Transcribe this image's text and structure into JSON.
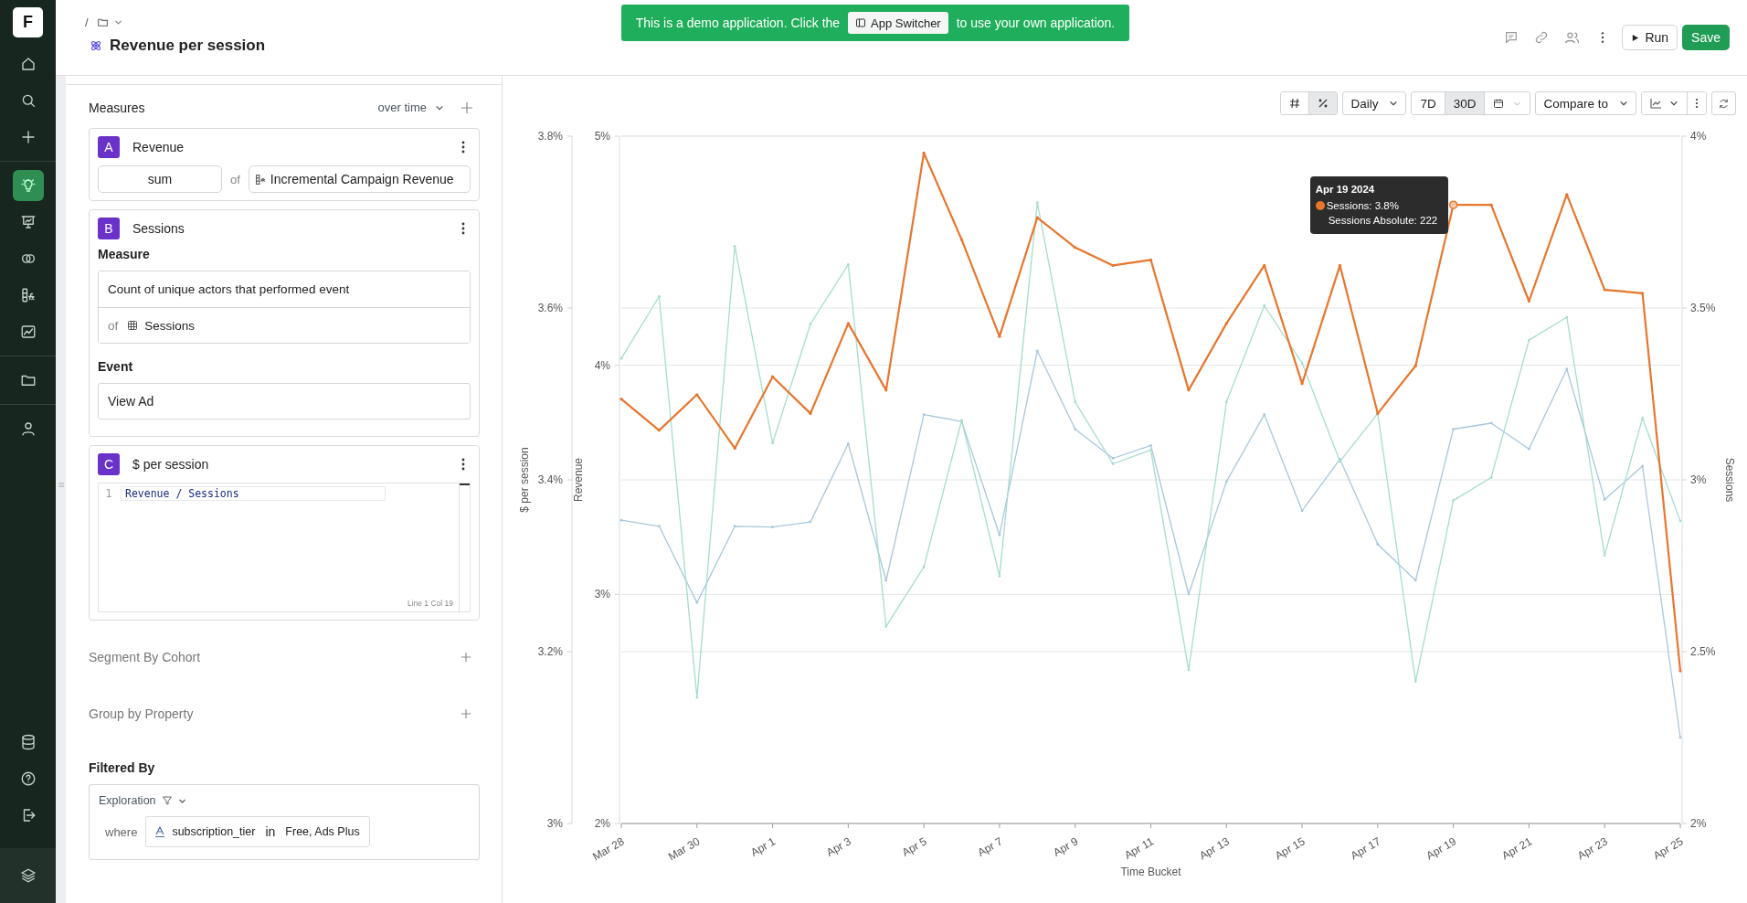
{
  "sidebar": {
    "logo": "F",
    "top_groups": [
      [
        {
          "kind": "home",
          "selected": false
        },
        {
          "kind": "search",
          "selected": false
        },
        {
          "kind": "plus",
          "selected": false
        }
      ],
      [
        {
          "kind": "bulb",
          "selected": true
        },
        {
          "kind": "presentation",
          "selected": false
        },
        {
          "kind": "circles",
          "selected": false
        },
        {
          "kind": "formula",
          "selected": false
        },
        {
          "kind": "chart",
          "selected": false
        }
      ],
      [
        {
          "kind": "folder",
          "selected": false
        }
      ],
      [
        {
          "kind": "user",
          "selected": false
        }
      ]
    ],
    "bottom": [
      {
        "kind": "database",
        "selected": false
      },
      {
        "kind": "help",
        "selected": false
      },
      {
        "kind": "logout",
        "selected": false
      }
    ]
  },
  "header": {
    "breadcrumb_separator": "/",
    "title": "Revenue per session",
    "banner": {
      "before": "This is a demo application. Click the",
      "button": "App Switcher",
      "after": "to use your own application."
    },
    "run": "Run",
    "save": "Save"
  },
  "measures": {
    "title": "Measures",
    "mode": "over time",
    "items": [
      {
        "kind": "aggregate",
        "letter": "A",
        "name": "Revenue",
        "aggregation": "sum",
        "of": "of",
        "property": "Incremental Campaign Revenue"
      },
      {
        "kind": "event",
        "letter": "B",
        "name": "Sessions",
        "measure_label": "Measure",
        "measure": "Count of unique actors that performed event",
        "of": "of",
        "table": "Sessions",
        "event_label": "Event",
        "event": "View Ad"
      },
      {
        "kind": "formula",
        "letter": "C",
        "name": "$ per session",
        "line_number": "1",
        "formula": "Revenue / Sessions",
        "cursor": "Line 1 Col 19"
      }
    ]
  },
  "sections": [
    {
      "title": "Segment By Cohort"
    },
    {
      "title": "Group by Property"
    }
  ],
  "filters": {
    "title": "Filtered By",
    "scope": "Exploration",
    "conditions": [
      {
        "where": "where",
        "property": "subscription_tier",
        "operator": "in",
        "values": "Free, Ads Plus"
      }
    ]
  },
  "chart_toolbar": {
    "format": [
      {
        "kind": "number",
        "selected": false
      },
      {
        "kind": "percent",
        "selected": true
      }
    ],
    "granularity": "Daily",
    "ranges": [
      {
        "label": "7D",
        "selected": false
      },
      {
        "label": "30D",
        "selected": true
      }
    ],
    "compare": "Compare to"
  },
  "chart": {
    "tooltip": {
      "color": "#e8762c",
      "lines": [
        {
          "kind": "value",
          "text": "Sessions: 3.8%"
        },
        {
          "kind": "detail",
          "text": "Sessions Absolute: 222"
        }
      ]
    },
    "chart_data": {
      "type": "line",
      "xlabel": "Time Bucket",
      "ylabel": "Revenue",
      "y2label": "Sessions",
      "y3label": "$ per session",
      "grid": true,
      "categories": [
        "Mar 28",
        null,
        "Mar 30",
        null,
        "Apr 1",
        null,
        "Apr 3",
        null,
        "Apr 5",
        null,
        "Apr 7",
        null,
        "Apr 9",
        null,
        "Apr 11",
        null,
        "Apr 13",
        null,
        "Apr 15",
        null,
        "Apr 17",
        null,
        "Apr 19",
        null,
        "Apr 21",
        null,
        "Apr 23",
        null,
        "Apr 25"
      ],
      "ylim": [
        2,
        5
      ],
      "yticks": [
        {
          "value": 5,
          "label": "5%"
        },
        {
          "value": 4,
          "label": "4%"
        },
        {
          "value": 3,
          "label": "3%"
        },
        {
          "value": 2,
          "label": "2%"
        }
      ],
      "y2lim": [
        2,
        4
      ],
      "y2ticks": [
        {
          "value": 4,
          "label": "4%"
        },
        {
          "value": 3.5,
          "label": "3.5%"
        },
        {
          "value": 3,
          "label": "3%"
        },
        {
          "value": 2.5,
          "label": "2.5%"
        },
        {
          "value": 2,
          "label": "2%"
        }
      ],
      "y3lim": [
        3,
        3.8
      ],
      "y3ticks": [
        {
          "value": 3.8,
          "label": "3.8%"
        },
        {
          "value": 3.6,
          "label": "3.6%"
        },
        {
          "value": 3.4,
          "label": "3.4%"
        },
        {
          "value": 3.2,
          "label": "3.2%"
        },
        {
          "value": 3,
          "label": "3%"
        }
      ],
      "series": [
        {
          "color": "#e8762c",
          "axis": "y2",
          "values": [
            3.235,
            3.144,
            3.248,
            3.092,
            3.3,
            3.193,
            3.455,
            3.261,
            3.951,
            3.699,
            3.417,
            3.763,
            3.676,
            3.624,
            3.64,
            3.261,
            3.455,
            3.624,
            3.28,
            3.624,
            3.193,
            3.332,
            3.8,
            3.8,
            3.52,
            3.83,
            3.553,
            3.543,
            2.444
          ]
        },
        {
          "color": "#a6dccd",
          "values": [
            4.03,
            4.3,
            2.55,
            4.52,
            3.66,
            4.18,
            4.44,
            2.86,
            3.12,
            3.76,
            3.08,
            4.71,
            3.84,
            3.57,
            3.63,
            2.67,
            3.84,
            4.26,
            4.01,
            3.58,
            3.79,
            2.62,
            3.41,
            3.51,
            4.11,
            4.21,
            3.17,
            3.77,
            3.32
          ]
        },
        {
          "color": "#a8c7dc",
          "axis": "y3",
          "values": [
            3.353,
            3.346,
            3.257,
            3.346,
            3.345,
            3.351,
            3.442,
            3.283,
            3.476,
            3.468,
            3.336,
            3.55,
            3.459,
            3.425,
            3.44,
            3.267,
            3.398,
            3.476,
            3.364,
            3.424,
            3.325,
            3.283,
            3.459,
            3.466,
            3.436,
            3.529,
            3.377,
            3.416,
            3.1
          ]
        }
      ],
      "annotations": [
        "Apr 19 2024"
      ]
    }
  }
}
